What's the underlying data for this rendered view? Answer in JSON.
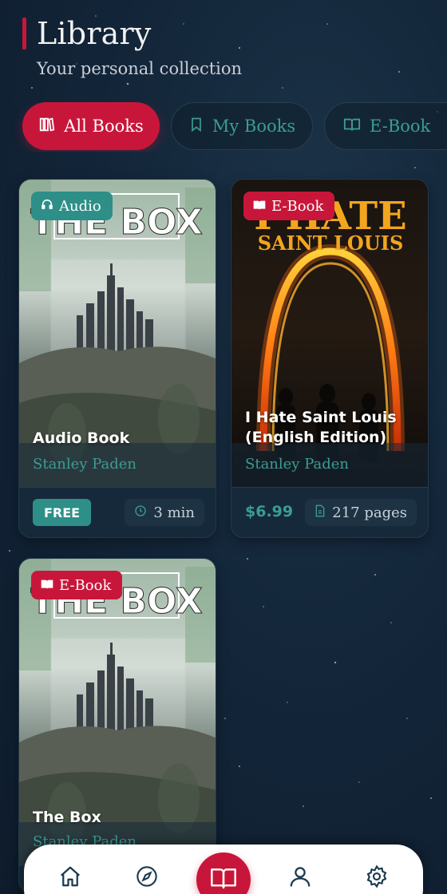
{
  "header": {
    "title": "Library",
    "subtitle": "Your personal collection"
  },
  "tabs": [
    {
      "label": "All Books",
      "icon": "books-icon",
      "active": true
    },
    {
      "label": "My Books",
      "icon": "bookmark-icon",
      "active": false
    },
    {
      "label": "E-Book",
      "icon": "open-book-icon",
      "active": false
    }
  ],
  "books": [
    {
      "badge": "Audio",
      "badge_icon": "headphones-icon",
      "cover_text": "THE BOX",
      "title": "Audio Book",
      "author": "Stanley Paden",
      "price": "FREE",
      "meta": "3 min",
      "meta_icon": "clock-icon"
    },
    {
      "badge": "E-Book",
      "badge_icon": "book-icon",
      "cover_text_top": "I HATE",
      "cover_text_bottom": "SAINT LOUIS",
      "title": "I Hate Saint Louis (English Edition)",
      "author": "Stanley Paden",
      "price": "$6.99",
      "meta": "217 pages",
      "meta_icon": "page-icon"
    },
    {
      "badge": "E-Book",
      "badge_icon": "book-icon",
      "cover_text": "THE BOX",
      "title": "The Box",
      "author": "Stanley Paden"
    }
  ],
  "bottom_nav": [
    {
      "icon": "home-icon"
    },
    {
      "icon": "compass-icon"
    },
    {
      "icon": "library-book-icon",
      "active": true
    },
    {
      "icon": "profile-icon"
    },
    {
      "icon": "settings-icon"
    }
  ],
  "colors": {
    "accent": "#c8163a",
    "teal": "#2d8f88",
    "background": "#13263a"
  }
}
